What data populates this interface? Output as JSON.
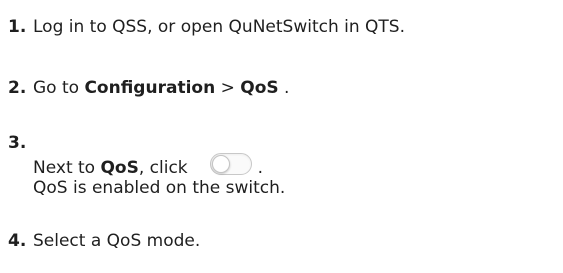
{
  "steps": [
    {
      "number": "1.",
      "text": "Log in to QSS, or open QuNetSwitch in QTS."
    },
    {
      "number": "2.",
      "prefix": "Go to ",
      "menu": "Configuration",
      "separator": " > ",
      "submenu": "QoS",
      "suffix": " ."
    },
    {
      "number": "3.",
      "prefix": "Next to ",
      "target": "QoS",
      "middle": ", click",
      "control_icon": "toggle-switch-off",
      "suffix": ".",
      "result": "QoS is enabled on the switch."
    },
    {
      "number": "4.",
      "text": "Select a QoS mode."
    }
  ]
}
